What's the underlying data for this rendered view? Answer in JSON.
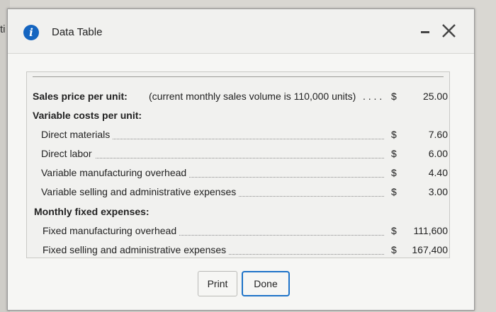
{
  "background": {
    "fragment_text": "ti"
  },
  "dialog": {
    "title": "Data Table",
    "info_icon": "i"
  },
  "table": {
    "sales_price": {
      "label": "Sales price per unit:",
      "note": "(current monthly sales volume is 110,000 units)",
      "dots": ". . . .",
      "currency": "$",
      "value": "25.00"
    },
    "variable_costs": {
      "heading": "Variable costs per unit:",
      "items": [
        {
          "label": "Direct materials",
          "currency": "$",
          "value": "7.60"
        },
        {
          "label": "Direct labor",
          "currency": "$",
          "value": "6.00"
        },
        {
          "label": "Variable manufacturing overhead",
          "currency": "$",
          "value": "4.40"
        },
        {
          "label": "Variable selling and administrative expenses",
          "currency": "$",
          "value": "3.00"
        }
      ]
    },
    "fixed_expenses": {
      "heading": "Monthly fixed expenses:",
      "items": [
        {
          "label": "Fixed manufacturing overhead",
          "currency": "$",
          "value": "111,600"
        },
        {
          "label": "Fixed selling and administrative expenses",
          "currency": "$",
          "value": "167,400"
        }
      ]
    }
  },
  "buttons": {
    "print_label": "Print",
    "done_label": "Done"
  },
  "icons": {
    "info": "info-icon",
    "minimize": "minimize-icon",
    "close": "close-icon"
  },
  "colors": {
    "info_icon": "#1565c0",
    "focus_border": "#1e73c8"
  }
}
